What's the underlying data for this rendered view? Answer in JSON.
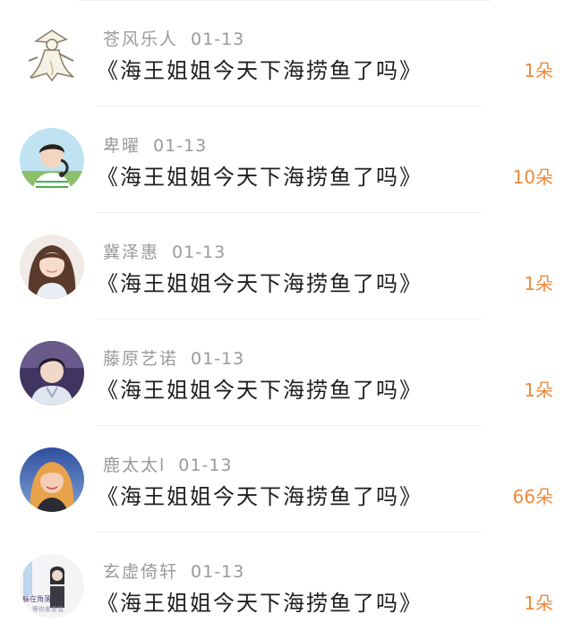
{
  "comments": [
    {
      "name": "苍风乐人",
      "date": "01-13",
      "title": "《海王姐姐今天下海捞鱼了吗》",
      "gift": "1朵"
    },
    {
      "name": "卑曜",
      "date": "01-13",
      "title": "《海王姐姐今天下海捞鱼了吗》",
      "gift": "10朵"
    },
    {
      "name": "冀泽惠",
      "date": "01-13",
      "title": "《海王姐姐今天下海捞鱼了吗》",
      "gift": "1朵"
    },
    {
      "name": "藤原艺诺",
      "date": "01-13",
      "title": "《海王姐姐今天下海捞鱼了吗》",
      "gift": "1朵"
    },
    {
      "name": "鹿太太l",
      "date": "01-13",
      "title": "《海王姐姐今天下海捞鱼了吗》",
      "gift": "66朵"
    },
    {
      "name": "玄虚倚轩",
      "date": "01-13",
      "title": "《海王姐姐今天下海捞鱼了吗》",
      "gift": "1朵"
    }
  ],
  "avatar_text": {
    "line1": "躲在角落",
    "line2": "等你来爱我"
  },
  "colors": {
    "gift": "#ed8a3c",
    "name": "#9a9a9a",
    "title": "#1e1e1e",
    "divider": "#efefef"
  }
}
